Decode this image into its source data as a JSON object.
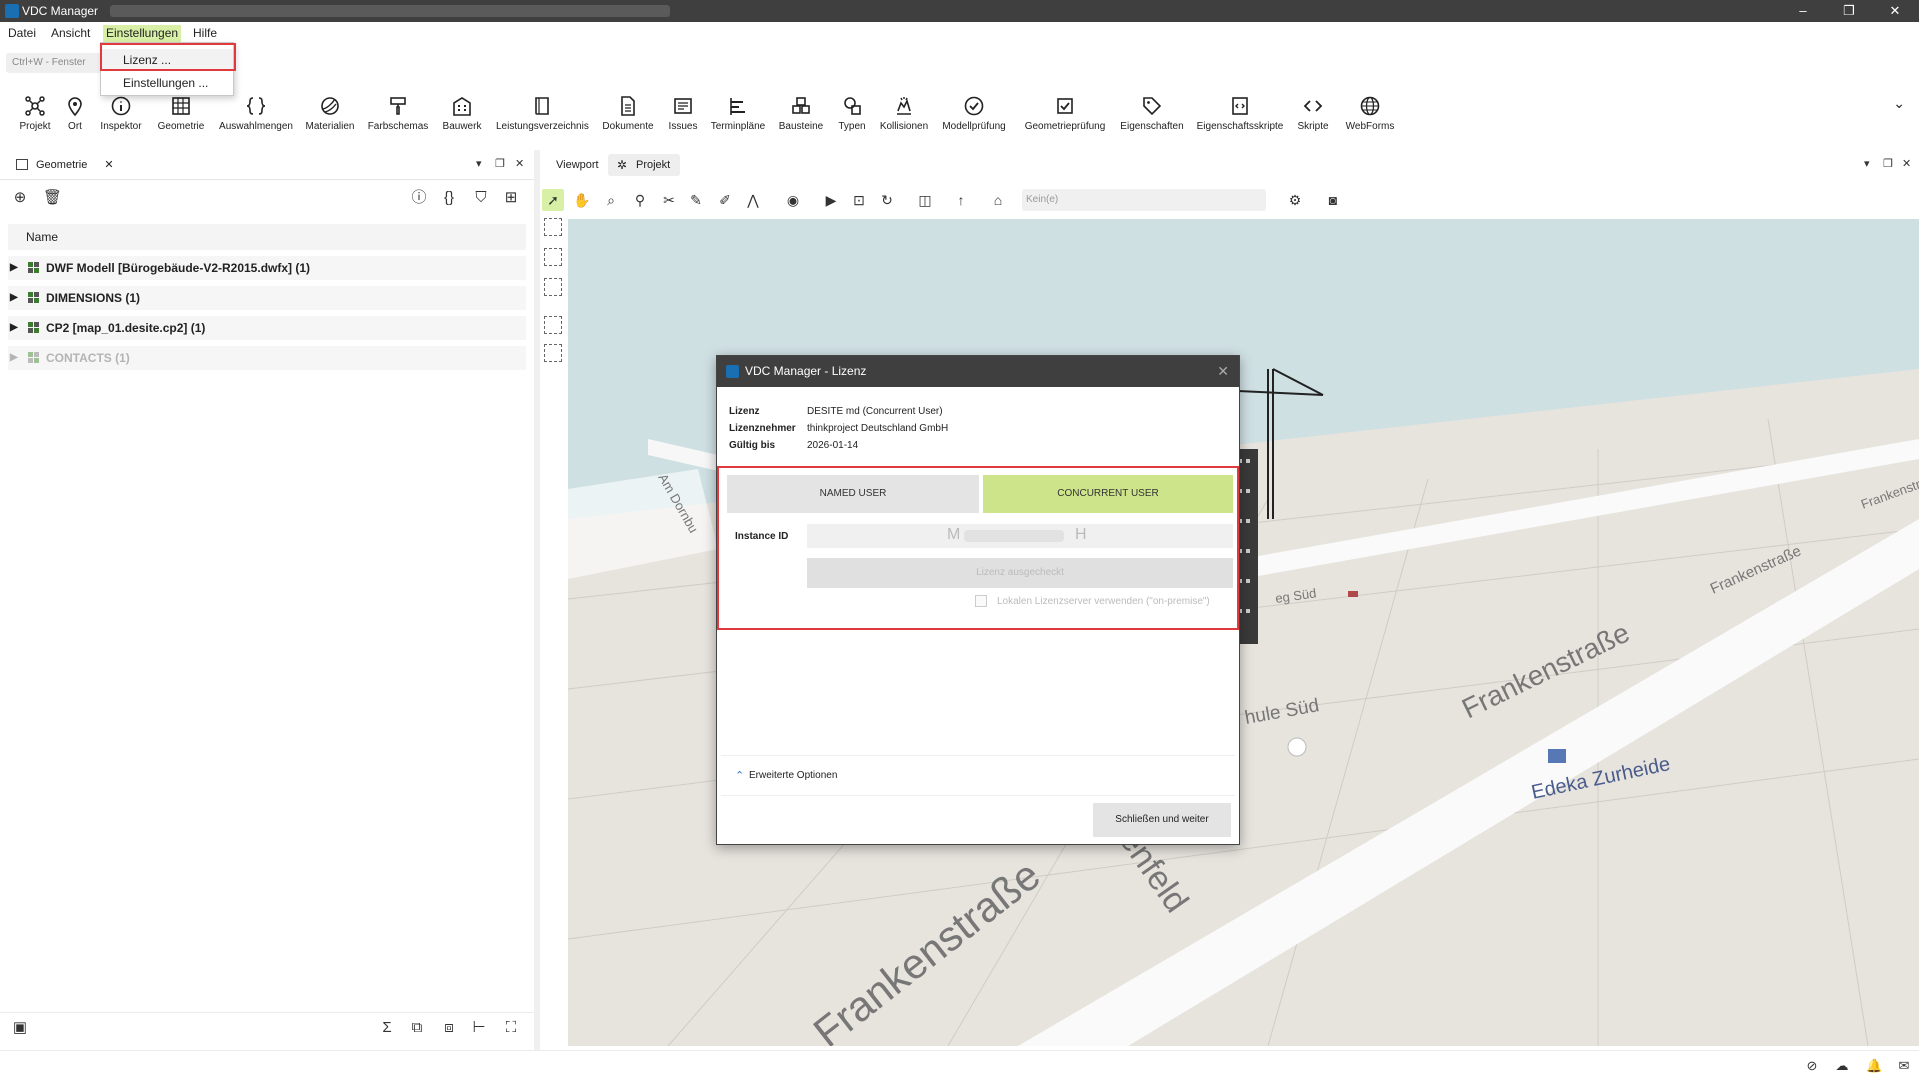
{
  "window": {
    "title": "VDC Manager",
    "controls": {
      "minimize": "–",
      "maximize": "❐",
      "close": "✕"
    }
  },
  "menubar": {
    "items": [
      {
        "label": "Datei"
      },
      {
        "label": "Ansicht"
      },
      {
        "label": "Einstellungen"
      },
      {
        "label": "Hilfe"
      }
    ]
  },
  "quickbar": {
    "text": "Ctrl+W  -  Fenster"
  },
  "dropdown": {
    "items": [
      {
        "label": "Lizenz ..."
      },
      {
        "label": "Einstellungen ..."
      }
    ]
  },
  "ribbon": {
    "buttons": [
      {
        "label": "Projekt",
        "icon": "project-icon"
      },
      {
        "label": "Ort",
        "icon": "location-pin-icon"
      },
      {
        "label": "Inspektor",
        "icon": "info-icon"
      },
      {
        "label": "Geometrie",
        "icon": "grid-building-icon"
      },
      {
        "label": "Auswahlmengen",
        "icon": "braces-icon"
      },
      {
        "label": "Materialien",
        "icon": "material-sphere-icon"
      },
      {
        "label": "Farbschemas",
        "icon": "paint-roller-icon"
      },
      {
        "label": "Bauwerk",
        "icon": "building-icon"
      },
      {
        "label": "Leistungsverzeichnis",
        "icon": "book-icon"
      },
      {
        "label": "Dokumente",
        "icon": "document-icon"
      },
      {
        "label": "Issues",
        "icon": "issues-icon"
      },
      {
        "label": "Terminpläne",
        "icon": "schedule-icon"
      },
      {
        "label": "Bausteine",
        "icon": "blocks-icon"
      },
      {
        "label": "Typen",
        "icon": "types-icon"
      },
      {
        "label": "Kollisionen",
        "icon": "collision-icon"
      },
      {
        "label": "Modellprüfung",
        "icon": "check-circle-icon"
      },
      {
        "label": "Geometrieprüfung",
        "icon": "check-box-icon"
      },
      {
        "label": "Eigenschaften",
        "icon": "tag-icon"
      },
      {
        "label": "Eigenschaftsskripte",
        "icon": "script-file-icon"
      },
      {
        "label": "Skripte",
        "icon": "code-icon"
      },
      {
        "label": "WebForms",
        "icon": "globe-icon"
      }
    ]
  },
  "left_panel": {
    "tab_label": "Geometrie",
    "column_header": "Name",
    "rows": [
      {
        "label": "DWF Modell [Bürogebäude-V2-R2015.dwfx] (1)",
        "dim": false
      },
      {
        "label": "DIMENSIONS (1)",
        "dim": false
      },
      {
        "label": "CP2 [map_01.desite.cp2] (1)",
        "dim": false
      },
      {
        "label": "CONTACTS (1)",
        "dim": true
      }
    ]
  },
  "right_panel": {
    "tabs": [
      {
        "label": "Viewport"
      },
      {
        "label": "Projekt"
      }
    ],
    "search_placeholder": "Kein(e)"
  },
  "map": {
    "streets": [
      {
        "label": "Frankenstraße"
      },
      {
        "label": "Frankenstraße"
      },
      {
        "label": "Frankenstraße"
      },
      {
        "label": "enfeld"
      },
      {
        "label": "Frankenstraße"
      }
    ],
    "places": [
      {
        "label": "Edeka Zurheide"
      },
      {
        "label": "hule Süd"
      },
      {
        "label": "eg Süd"
      },
      {
        "label": "Am Dornbu"
      }
    ]
  },
  "license_dialog": {
    "title": "VDC Manager - Lizenz",
    "info": [
      {
        "label": "Lizenz",
        "value": "DESITE md (Concurrent User)"
      },
      {
        "label": "Lizenznehmer",
        "value": "thinkproject Deutschland GmbH"
      },
      {
        "label": "Gültig bis",
        "value": "2026-01-14"
      }
    ],
    "named_user_label": "NAMED USER",
    "concurrent_user_label": "CONCURRENT USER",
    "instance_id_label": "Instance ID",
    "instance_id_value_start": "M",
    "instance_id_value_end": "H",
    "check_button_label": "Lizenz ausgecheckt",
    "onprem_label": "Lokalen Lizenzserver verwenden (\"on-premise\")",
    "advanced_options_label": "Erweiterte Optionen",
    "close_button_label": "Schließen und weiter"
  },
  "colors": {
    "accent": "#d7f0a6",
    "concurrent_selected": "#cde48b",
    "highlight_red": "#e0393e",
    "titlebar": "#3f3f3f"
  }
}
